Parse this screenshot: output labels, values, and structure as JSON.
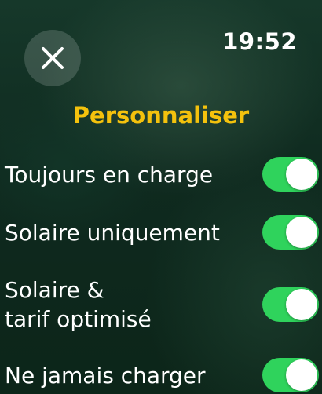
{
  "header": {
    "time": "19:52",
    "title": "Personnaliser"
  },
  "close_button": {
    "icon": "close-icon"
  },
  "options": [
    {
      "label": "Toujours en charge",
      "on": true
    },
    {
      "label": "Solaire uniquement",
      "on": true
    },
    {
      "label": "Solaire &\ntarif optimisé",
      "on": true
    },
    {
      "label": "Ne jamais charger",
      "on": true
    }
  ],
  "colors": {
    "title": "#f4c20d",
    "toggle_on": "#2fd35c",
    "close_button_bg": "#3d5a4b"
  }
}
